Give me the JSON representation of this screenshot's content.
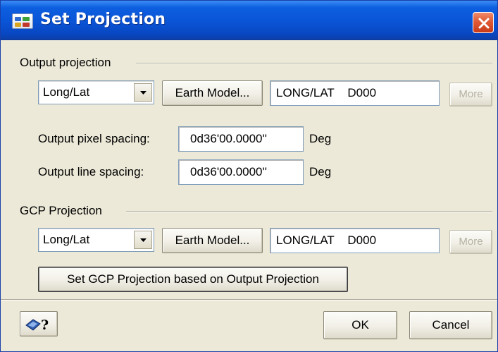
{
  "window": {
    "title": "Set Projection",
    "icon": "app-raster-icon",
    "close_icon": "close-icon",
    "titlebar_color": "#0A54D6",
    "close_color": "#E05A35",
    "face_color": "#ECE9D8"
  },
  "output_projection": {
    "group_label": "Output projection",
    "projection_select": "Long/Lat",
    "earth_model_label": "Earth Model...",
    "projection_string": "LONG/LAT    D000",
    "more_label": "More",
    "pixel_spacing_label": "Output pixel spacing:",
    "pixel_spacing_value": "0d36'00.0000''",
    "pixel_spacing_unit": "Deg",
    "line_spacing_label": "Output line spacing:",
    "line_spacing_value": "0d36'00.0000''",
    "line_spacing_unit": "Deg"
  },
  "gcp_projection": {
    "group_label": "GCP Projection",
    "projection_select": "Long/Lat",
    "earth_model_label": "Earth Model...",
    "projection_string": "LONG/LAT    D000",
    "more_label": "More",
    "set_from_output_label": "Set GCP Projection based on Output Projection"
  },
  "footer": {
    "help_icon": "help-book-icon",
    "ok_label": "OK",
    "cancel_label": "Cancel"
  }
}
